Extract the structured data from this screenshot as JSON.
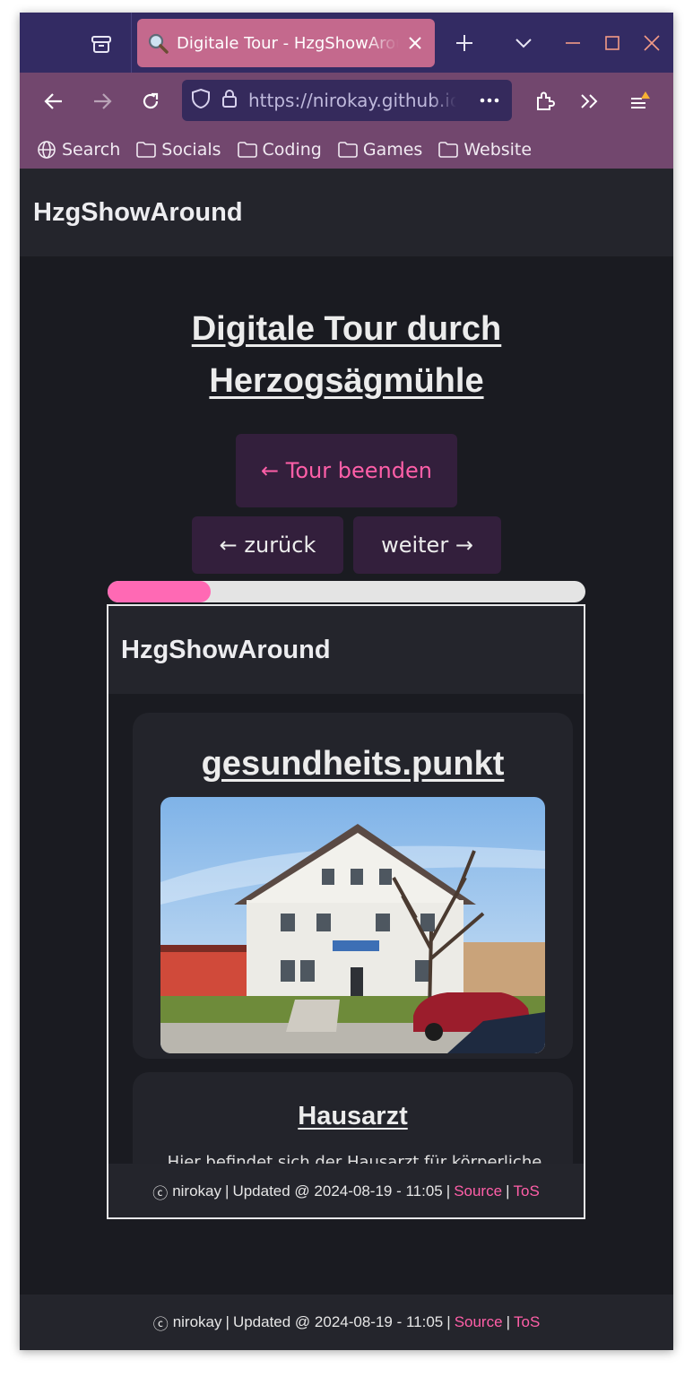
{
  "browser": {
    "tab": {
      "title": "Digitale Tour - HzgShowAround",
      "favicon": "magnifier-emoji-icon"
    },
    "url": "https://nirokay.github.io/HzgShowAround/tour.html",
    "bookmarks": [
      "Search",
      "Socials",
      "Coding",
      "Games",
      "Website"
    ],
    "colors": {
      "tabbar": "#332b63",
      "toolbar": "#72476e",
      "active_tab": "#c4698d"
    }
  },
  "site": {
    "name": "HzgShowAround"
  },
  "page": {
    "title_line1": "Digitale Tour durch",
    "title_line2": "Herzogsägmühle",
    "end_tour": "← Tour beenden",
    "back": "← zurück",
    "next": "weiter →",
    "progress_percent": 21.5
  },
  "frame": {
    "site_name": "HzgShowAround",
    "location_title": "gesundheits.punkt",
    "photo_alt": "gesundheits.punkt building",
    "sub_title": "Hausarzt",
    "sub_text": "Hier befindet sich der Hausarzt für körperliche"
  },
  "footer": {
    "copyright_symbol": "ⓒ",
    "author": "nirokay",
    "updated": "Updated @ 2024-08-19 - 11:05",
    "separator": "|",
    "source": "Source",
    "tos": "ToS"
  },
  "accent": "#ff69b4"
}
